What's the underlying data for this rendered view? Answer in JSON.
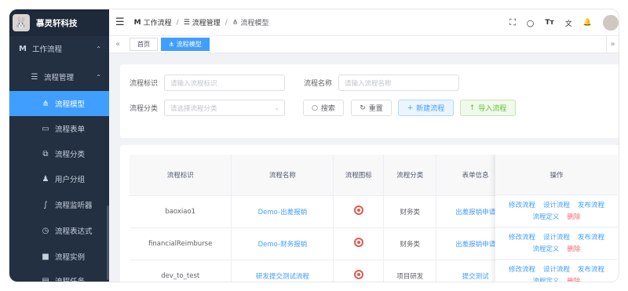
{
  "app": {
    "title": "慕灵轩科技",
    "logo_glyph": "🐰"
  },
  "sidebar": {
    "items": [
      {
        "label": "工作流程",
        "icon": "workflow-icon",
        "glyph": "M"
      },
      {
        "label": "流程管理",
        "icon": "list-icon",
        "glyph": "☰"
      },
      {
        "label": "流程模型",
        "icon": "model-icon",
        "glyph": "⋔"
      },
      {
        "label": "流程表单",
        "icon": "form-icon",
        "glyph": "▭"
      },
      {
        "label": "流程分类",
        "icon": "category-icon",
        "glyph": "⧉"
      },
      {
        "label": "用户分组",
        "icon": "user-group-icon",
        "glyph": "♟"
      },
      {
        "label": "流程监听器",
        "icon": "listener-icon",
        "glyph": "∫"
      },
      {
        "label": "流程表达式",
        "icon": "expression-icon",
        "glyph": "◷"
      },
      {
        "label": "流程实例",
        "icon": "instance-icon",
        "glyph": "■"
      },
      {
        "label": "流程任务",
        "icon": "task-icon",
        "glyph": "▤"
      }
    ],
    "arrow": "⌃"
  },
  "navbar": {
    "hamburger": "☰",
    "breadcrumb": [
      {
        "label": "工作流程",
        "glyph": "M"
      },
      {
        "label": "流程管理",
        "glyph": "☰"
      },
      {
        "label": "流程模型",
        "glyph": "⋔"
      }
    ],
    "separator": "/",
    "icons": {
      "fullscreen": "⛶",
      "search": "○",
      "size": "Tт",
      "lang": "文",
      "bell": "🔔"
    }
  },
  "tags": {
    "left_arrow": "«",
    "right_arrow": "»",
    "items": [
      {
        "label": "首页"
      },
      {
        "label": "流程模型",
        "glyph": "⋔"
      }
    ]
  },
  "search": {
    "key_label": "流程标识",
    "key_placeholder": "请输入流程标识",
    "name_label": "流程名称",
    "name_placeholder": "请输入流程名称",
    "category_label": "流程分类",
    "category_placeholder": "请选择流程分类",
    "search_btn": "搜索",
    "reset_btn": "重置",
    "new_btn": "新建流程",
    "import_btn": "导入流程",
    "search_glyph": "○",
    "reset_glyph": "↻",
    "new_glyph": "+",
    "import_glyph": "↑",
    "dropdown_glyph": "⌄"
  },
  "table": {
    "headers": [
      "流程标识",
      "流程名称",
      "流程图标",
      "流程分类",
      "表单信息",
      "操作"
    ],
    "rows": [
      {
        "key": "baoxiao1",
        "name": "Demo-出差报销",
        "category": "财务类",
        "form": "出差报销申请"
      },
      {
        "key": "financialReimburse",
        "name": "Demo-财务报销",
        "category": "财务类",
        "form": "出差报销申请"
      },
      {
        "key": "dev_to_test",
        "name": "研发提交测试流程",
        "category": "项目研发",
        "form": "提交测试"
      }
    ],
    "ops": {
      "edit": "修改流程",
      "design": "设计流程",
      "publish": "发布流程",
      "define": "流程定义",
      "delete": "删除"
    }
  }
}
